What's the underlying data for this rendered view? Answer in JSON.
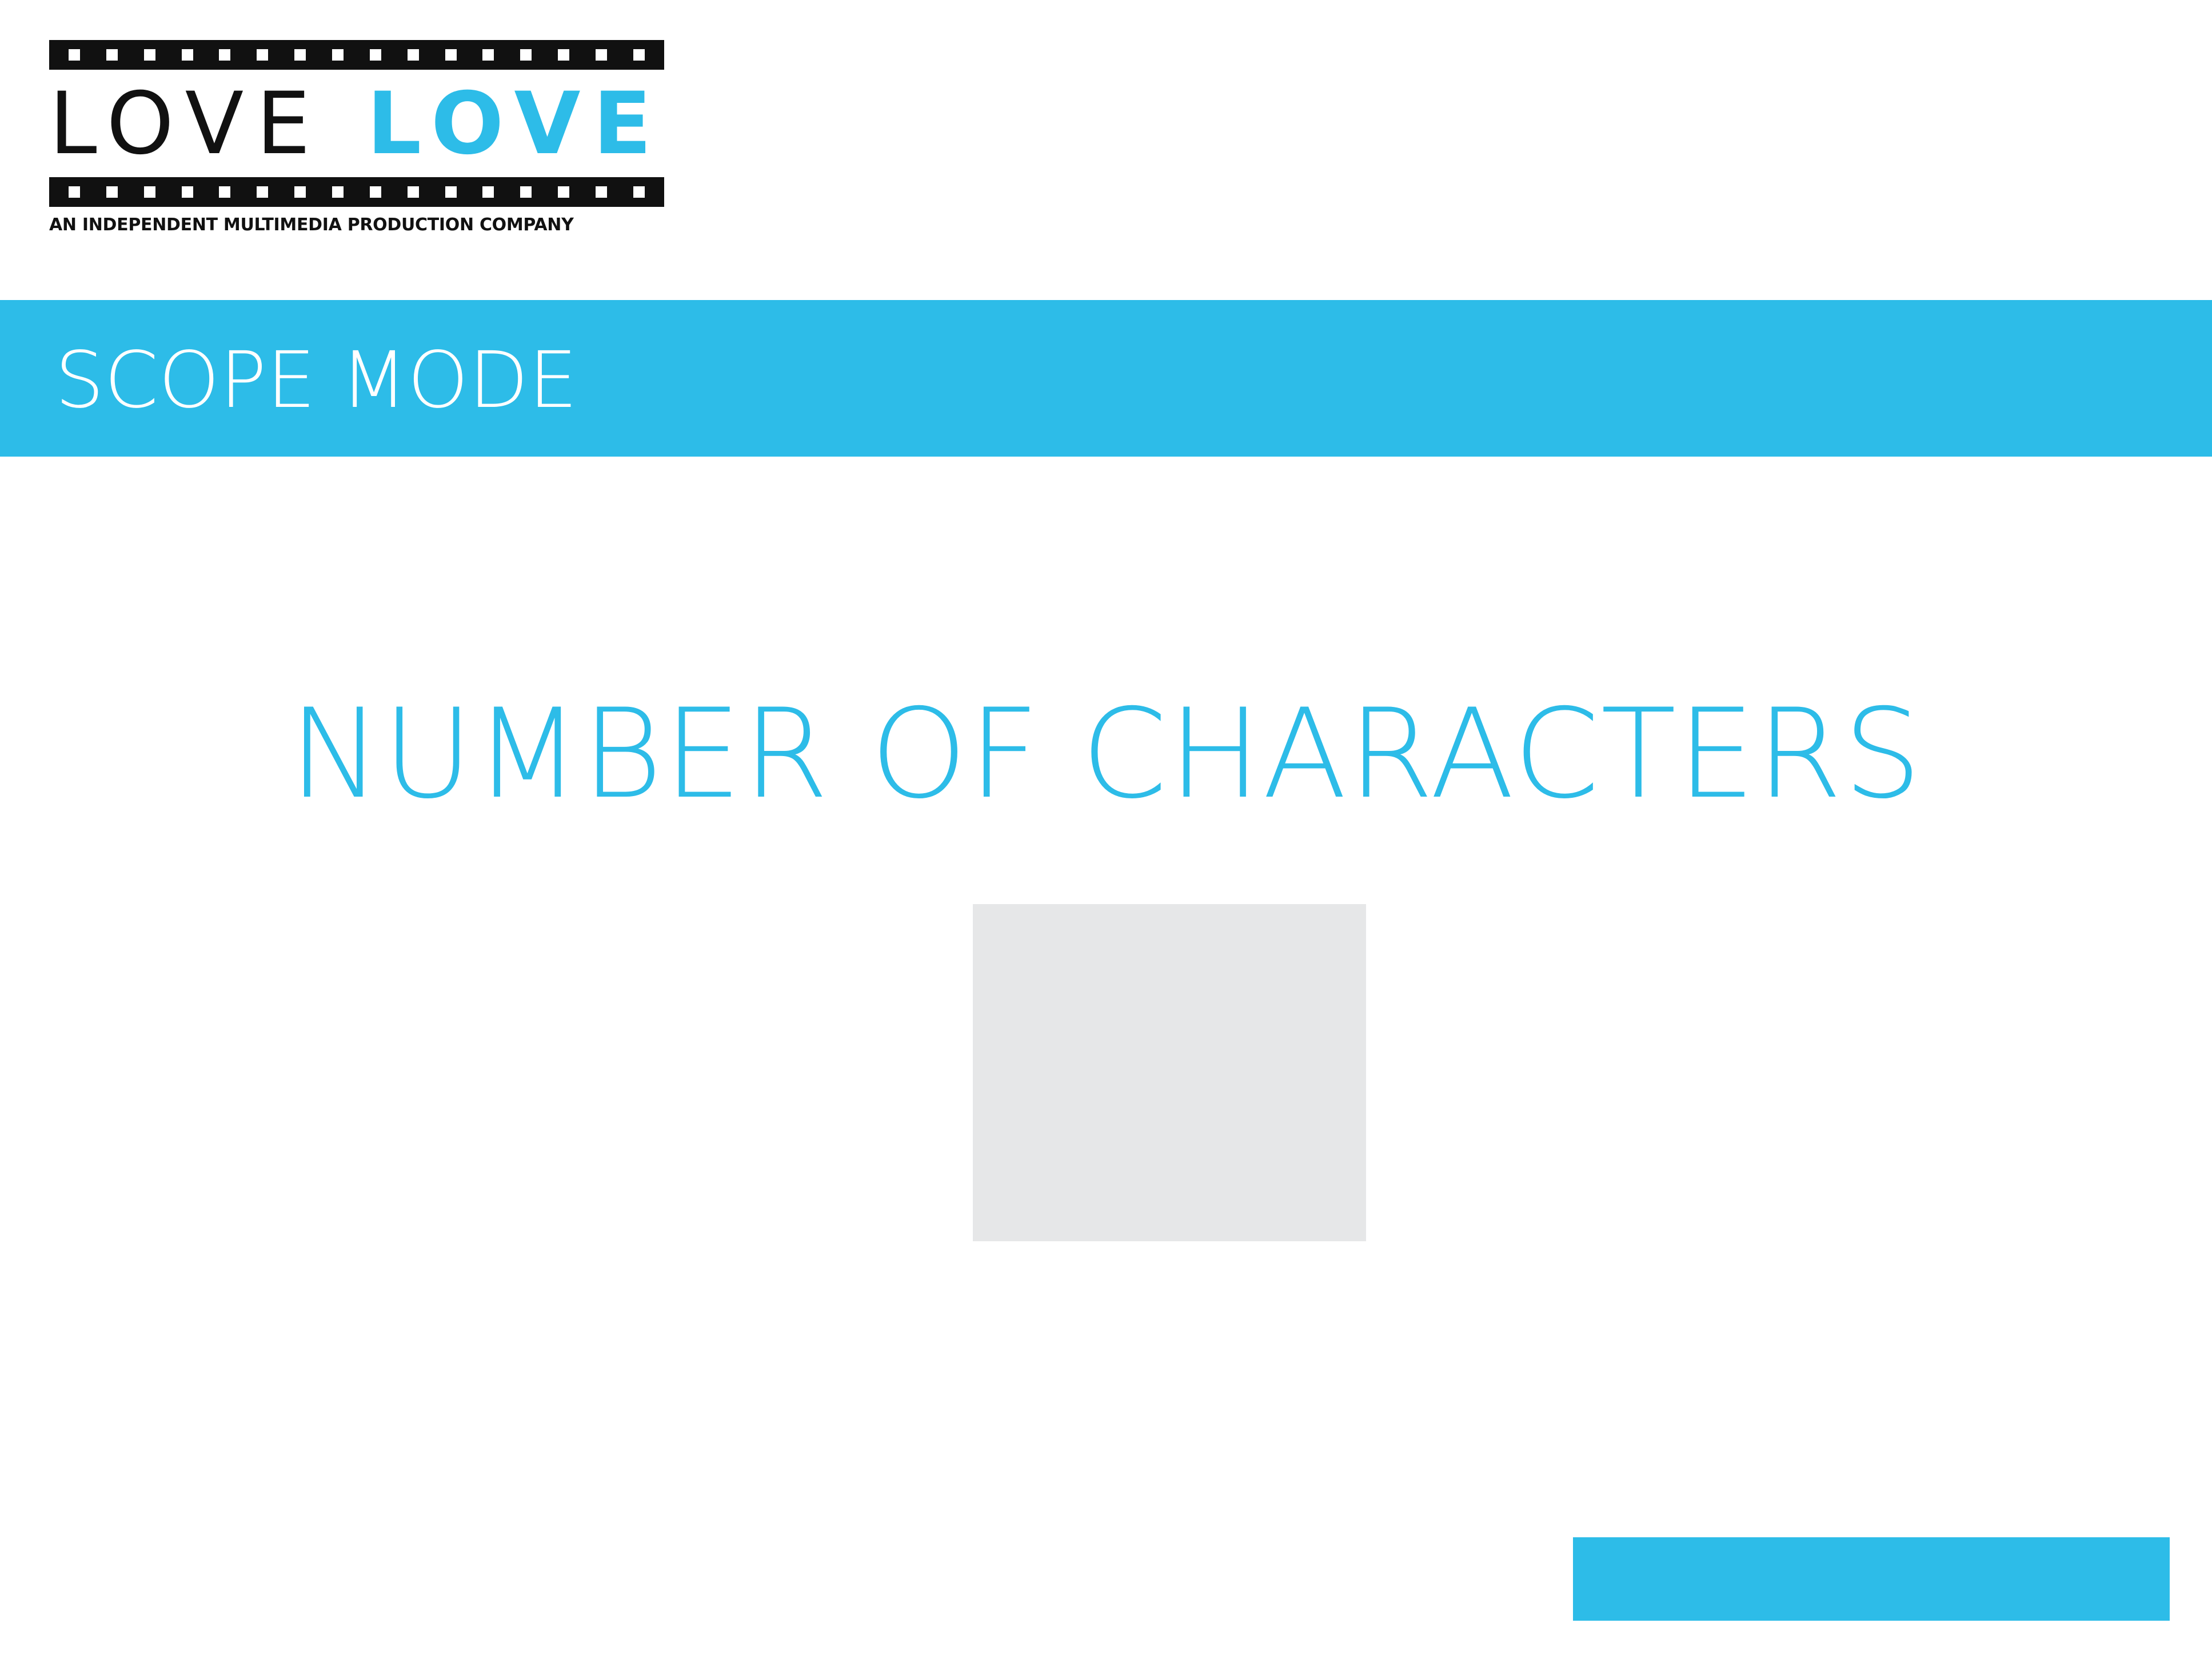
{
  "logo": {
    "word_dark": "LOVE",
    "word_accent": "LOVE",
    "tagline": "AN INDEPENDENT MULTIMEDIA PRODUCTION COMPANY"
  },
  "header": {
    "mode_title": "SCOPE MODE"
  },
  "main": {
    "question": "NUMBER OF CHARACTERS",
    "answer_value": ""
  },
  "footer": {
    "submit_label": ""
  },
  "colors": {
    "accent": "#2dbce8",
    "input_background": "#e6e7e8",
    "logo_dark": "#111111",
    "background": "#ffffff"
  }
}
